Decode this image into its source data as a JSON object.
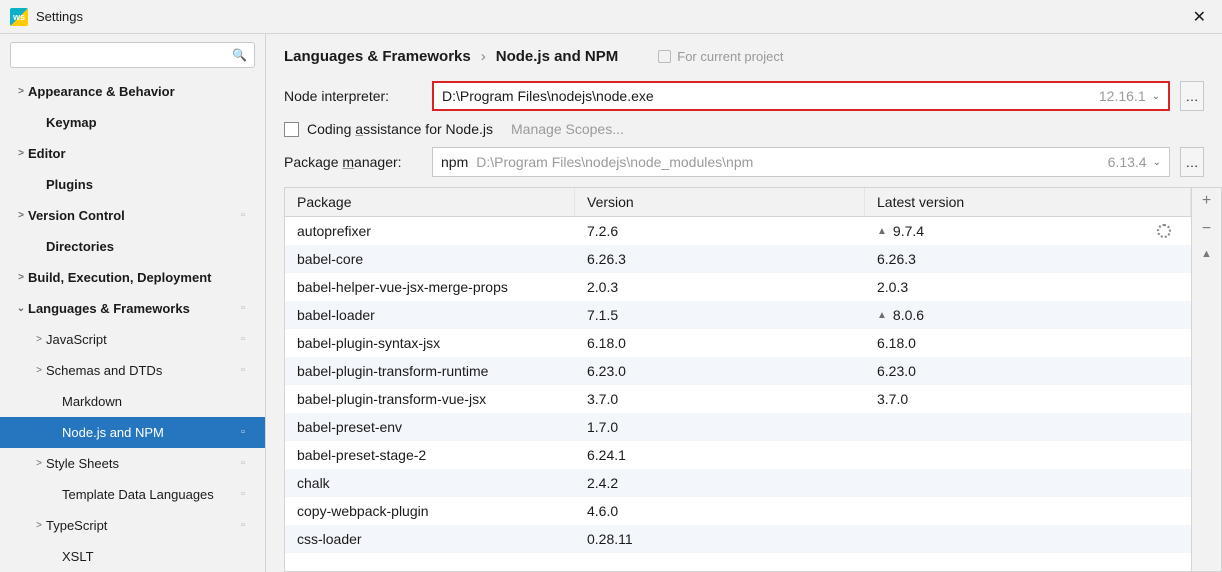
{
  "window": {
    "title": "Settings"
  },
  "search": {
    "placeholder": ""
  },
  "sidebar": {
    "items": [
      {
        "label": "Appearance & Behavior",
        "depth": "d0",
        "arrow": ">",
        "badge": ""
      },
      {
        "label": "Keymap",
        "depth": "d1b",
        "arrow": "",
        "badge": ""
      },
      {
        "label": "Editor",
        "depth": "d0",
        "arrow": ">",
        "badge": ""
      },
      {
        "label": "Plugins",
        "depth": "d1b",
        "arrow": "",
        "badge": ""
      },
      {
        "label": "Version Control",
        "depth": "d0",
        "arrow": ">",
        "badge": "▫"
      },
      {
        "label": "Directories",
        "depth": "d1b",
        "arrow": "",
        "badge": ""
      },
      {
        "label": "Build, Execution, Deployment",
        "depth": "d0",
        "arrow": ">",
        "badge": ""
      },
      {
        "label": "Languages & Frameworks",
        "depth": "d0",
        "arrow": "⌄",
        "badge": "▫"
      },
      {
        "label": "JavaScript",
        "depth": "d1",
        "arrow": ">",
        "badge": "▫"
      },
      {
        "label": "Schemas and DTDs",
        "depth": "d1",
        "arrow": ">",
        "badge": "▫"
      },
      {
        "label": "Markdown",
        "depth": "d2",
        "arrow": "",
        "badge": ""
      },
      {
        "label": "Node.js and NPM",
        "depth": "d2",
        "arrow": "",
        "badge": "▫",
        "selected": true
      },
      {
        "label": "Style Sheets",
        "depth": "d1",
        "arrow": ">",
        "badge": "▫"
      },
      {
        "label": "Template Data Languages",
        "depth": "d2",
        "arrow": "",
        "badge": "▫"
      },
      {
        "label": "TypeScript",
        "depth": "d1",
        "arrow": ">",
        "badge": "▫"
      },
      {
        "label": "XSLT",
        "depth": "d2",
        "arrow": "",
        "badge": ""
      }
    ]
  },
  "breadcrumb": {
    "a": "Languages & Frameworks",
    "b": "Node.js and NPM",
    "for": "For current project"
  },
  "interpreter": {
    "label": "Node interpreter:",
    "value": "D:\\Program Files\\nodejs\\node.exe",
    "version": "12.16.1"
  },
  "coding": {
    "label_pre": "Coding ",
    "label_u": "a",
    "label_post": "ssistance for Node.js",
    "manage": "Manage Scopes..."
  },
  "pkgmgr": {
    "label_pre": "Package ",
    "label_u": "m",
    "label_post": "anager:",
    "name": "npm",
    "path": "D:\\Program Files\\nodejs\\node_modules\\npm",
    "version": "6.13.4"
  },
  "table": {
    "headers": {
      "pkg": "Package",
      "ver": "Version",
      "latest": "Latest version"
    },
    "rows": [
      {
        "pkg": "autoprefixer",
        "ver": "7.2.6",
        "latest": "9.7.4",
        "up": true,
        "spin": true
      },
      {
        "pkg": "babel-core",
        "ver": "6.26.3",
        "latest": "6.26.3"
      },
      {
        "pkg": "babel-helper-vue-jsx-merge-props",
        "ver": "2.0.3",
        "latest": "2.0.3"
      },
      {
        "pkg": "babel-loader",
        "ver": "7.1.5",
        "latest": "8.0.6",
        "up": true
      },
      {
        "pkg": "babel-plugin-syntax-jsx",
        "ver": "6.18.0",
        "latest": "6.18.0"
      },
      {
        "pkg": "babel-plugin-transform-runtime",
        "ver": "6.23.0",
        "latest": "6.23.0"
      },
      {
        "pkg": "babel-plugin-transform-vue-jsx",
        "ver": "3.7.0",
        "latest": "3.7.0"
      },
      {
        "pkg": "babel-preset-env",
        "ver": "1.7.0",
        "latest": ""
      },
      {
        "pkg": "babel-preset-stage-2",
        "ver": "6.24.1",
        "latest": ""
      },
      {
        "pkg": "chalk",
        "ver": "2.4.2",
        "latest": ""
      },
      {
        "pkg": "copy-webpack-plugin",
        "ver": "4.6.0",
        "latest": ""
      },
      {
        "pkg": "css-loader",
        "ver": "0.28.11",
        "latest": ""
      }
    ]
  },
  "sidebuttons": {
    "add": "+",
    "remove": "−",
    "up": "▲"
  }
}
